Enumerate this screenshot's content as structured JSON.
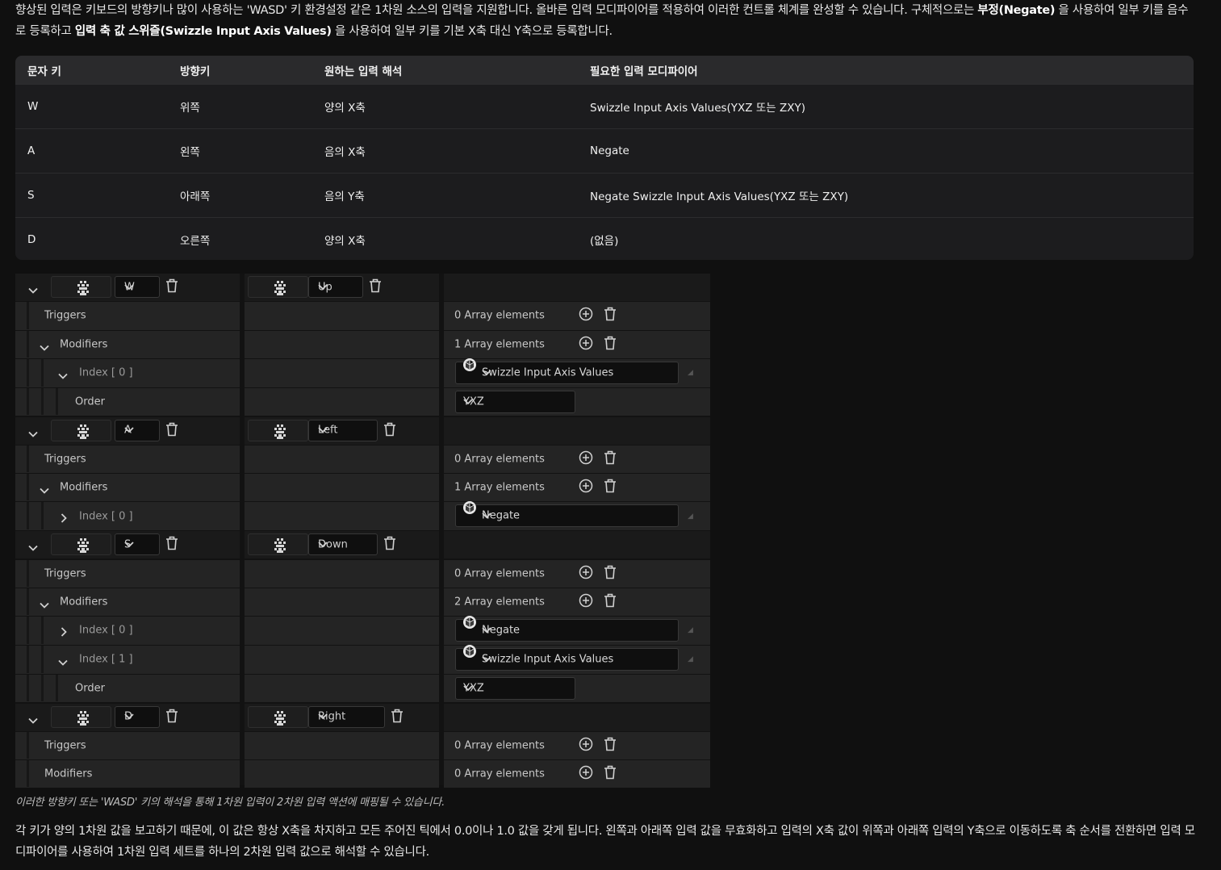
{
  "intro": {
    "p1": "향상된 입력은 키보드의 방향키나 많이 사용하는 'WASD' 키 환경설정 같은 1차원 소스의 입력을 지원합니다. 올바른 입력 모디파이어를 적용하여 이러한 컨트롤 체계를 완성할 수 있습니다. 구체적으로는 ",
    "b1": "부정(Negate)",
    "p2": " 을 사용하여 일부 키를 음수로 등록하고 ",
    "b2": "입력 축 값 스위즐(Swizzle Input Axis Values)",
    "p3": " 을 사용하여 일부 키를 기본 X축 대신 Y축으로 등록합니다."
  },
  "table": {
    "headers": [
      "문자 키",
      "방향키",
      "원하는 입력 해석",
      "필요한 입력 모디파이어"
    ],
    "rows": [
      [
        "W",
        "위쪽",
        "양의 X축",
        "Swizzle Input Axis Values(YXZ 또는 ZXY)"
      ],
      [
        "A",
        "왼쪽",
        "음의 X축",
        "Negate"
      ],
      [
        "S",
        "아래쪽",
        "음의 Y축",
        "Negate Swizzle Input Axis Values(YXZ 또는 ZXY)"
      ],
      [
        "D",
        "오른쪽",
        "양의 X축",
        "(없음)"
      ]
    ]
  },
  "editor": {
    "triggers_label": "Triggers",
    "modifiers_label": "Modifiers",
    "order_label": "Order",
    "groups": [
      {
        "key": "W",
        "arrow": "Up",
        "triggers": "0 Array elements",
        "modifiers": "1 Array elements",
        "mods": [
          {
            "index": "Index [ 0 ]",
            "expanded": true,
            "name": "Swizzle Input Axis Values",
            "order": "YXZ"
          }
        ]
      },
      {
        "key": "A",
        "arrow": "Left",
        "triggers": "0 Array elements",
        "modifiers": "1 Array elements",
        "mods": [
          {
            "index": "Index [ 0 ]",
            "expanded": false,
            "name": "Negate"
          }
        ]
      },
      {
        "key": "S",
        "arrow": "Down",
        "triggers": "0 Array elements",
        "modifiers": "2 Array elements",
        "mods": [
          {
            "index": "Index [ 0 ]",
            "expanded": false,
            "name": "Negate"
          },
          {
            "index": "Index [ 1 ]",
            "expanded": true,
            "name": "Swizzle Input Axis Values",
            "order": "YXZ"
          }
        ]
      },
      {
        "key": "D",
        "arrow": "Right",
        "triggers": "0 Array elements",
        "modifiers": "0 Array elements",
        "mods": []
      }
    ]
  },
  "caption": "이러한 방향키 또는 'WASD' 키의 해석을 통해 1차원 입력이 2차원 입력 액션에 매핑될 수 있습니다.",
  "outro": "각 키가 양의 1차원 값을 보고하기 때문에, 이 값은 항상 X축을 차지하고 모든 주어진 틱에서 0.0이나 1.0 값을 갖게 됩니다. 왼쪽과 아래쪽 입력 값을 무효화하고 입력의 X축 값이 위쪽과 아래쪽 입력의 Y축으로 이동하도록 축 순서를 전환하면 입력 모디파이어를 사용하여 1차원 입력 세트를 하나의 2차원 입력 값으로 해석할 수 있습니다."
}
